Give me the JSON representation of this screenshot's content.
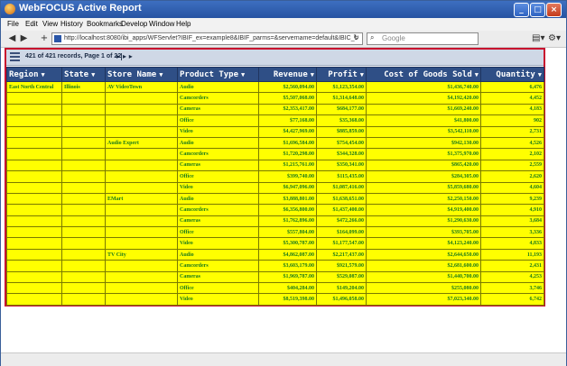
{
  "window": {
    "title": "WebFOCUS Active Report",
    "icon": "firefox-icon"
  },
  "menu": [
    "File",
    "Edit",
    "View",
    "History",
    "Bookmarks",
    "Develop",
    "Window",
    "Help"
  ],
  "nav": {
    "url": "http://localhost:8080/ibi_apps/WFServlet?IBIF_ex=example8&IBIF_parms=&servername=default&IBIC_s",
    "search_placeholder": "Google"
  },
  "report": {
    "records_text": "421 of 421 records, Page 1 of 22",
    "pager_symbols": "▸|▸ ▸",
    "columns": [
      {
        "label": "Region",
        "align": "left"
      },
      {
        "label": "State",
        "align": "left"
      },
      {
        "label": "Store Name",
        "align": "left"
      },
      {
        "label": "Product Type",
        "align": "left"
      },
      {
        "label": "Revenue",
        "align": "right"
      },
      {
        "label": "Profit",
        "align": "right"
      },
      {
        "label": "Cost of Goods Sold",
        "align": "right"
      },
      {
        "label": "Quantity",
        "align": "right"
      }
    ],
    "rows": [
      [
        "East North Central",
        "Illinois",
        "AV VideoTown",
        "Audio",
        "$2,560,094.00",
        "$1,123,354.00",
        "$1,436,740.00",
        "6,476"
      ],
      [
        "",
        "",
        "",
        "Camcorders",
        "$5,507,068.00",
        "$1,314,648.00",
        "$4,192,420.00",
        "4,452"
      ],
      [
        "",
        "",
        "",
        "Cameras",
        "$2,353,417.00",
        "$684,177.00",
        "$1,669,240.00",
        "4,183"
      ],
      [
        "",
        "",
        "",
        "Office",
        "$77,168.00",
        "$35,368.00",
        "$41,800.00",
        "902"
      ],
      [
        "",
        "",
        "",
        "Video",
        "$4,427,969.00",
        "$885,859.00",
        "$3,542,110.00",
        "2,731"
      ],
      [
        "",
        "",
        "Audio Expert",
        "Audio",
        "$1,696,584.00",
        "$754,454.00",
        "$942,130.00",
        "4,526"
      ],
      [
        "",
        "",
        "",
        "Camcorders",
        "$1,720,298.00",
        "$344,328.00",
        "$1,375,970.00",
        "2,102"
      ],
      [
        "",
        "",
        "",
        "Cameras",
        "$1,215,761.00",
        "$350,341.00",
        "$865,420.00",
        "2,559"
      ],
      [
        "",
        "",
        "",
        "Office",
        "$399,740.00",
        "$115,435.00",
        "$284,305.00",
        "2,620"
      ],
      [
        "",
        "",
        "",
        "Video",
        "$6,947,096.00",
        "$1,087,416.00",
        "$5,859,680.00",
        "4,604"
      ],
      [
        "",
        "",
        "EMart",
        "Audio",
        "$3,888,801.00",
        "$1,638,651.00",
        "$2,250,150.00",
        "9,239"
      ],
      [
        "",
        "",
        "",
        "Camcorders",
        "$6,356,800.00",
        "$1,437,400.00",
        "$4,919,400.00",
        "4,910"
      ],
      [
        "",
        "",
        "",
        "Cameras",
        "$1,762,896.00",
        "$472,266.00",
        "$1,290,630.00",
        "3,684"
      ],
      [
        "",
        "",
        "",
        "Office",
        "$557,804.00",
        "$164,099.00",
        "$393,705.00",
        "3,336"
      ],
      [
        "",
        "",
        "",
        "Video",
        "$5,300,787.00",
        "$1,177,547.00",
        "$4,123,240.00",
        "4,833"
      ],
      [
        "",
        "",
        "TV City",
        "Audio",
        "$4,862,087.00",
        "$2,217,437.00",
        "$2,644,650.00",
        "11,193"
      ],
      [
        "",
        "",
        "",
        "Camcorders",
        "$3,603,179.00",
        "$921,579.00",
        "$2,681,600.00",
        "2,431"
      ],
      [
        "",
        "",
        "",
        "Cameras",
        "$1,969,787.00",
        "$529,087.00",
        "$1,440,700.00",
        "4,253"
      ],
      [
        "",
        "",
        "",
        "Office",
        "$404,284.00",
        "$149,204.00",
        "$255,080.00",
        "3,746"
      ],
      [
        "",
        "",
        "",
        "Video",
        "$8,519,398.00",
        "$1,496,058.00",
        "$7,023,340.00",
        "6,742"
      ]
    ]
  },
  "colors": {
    "header_bg": "#2f4f86",
    "cell_bg": "#ffff00",
    "cell_text": "#1a7a1a",
    "report_border": "#c8102e"
  }
}
